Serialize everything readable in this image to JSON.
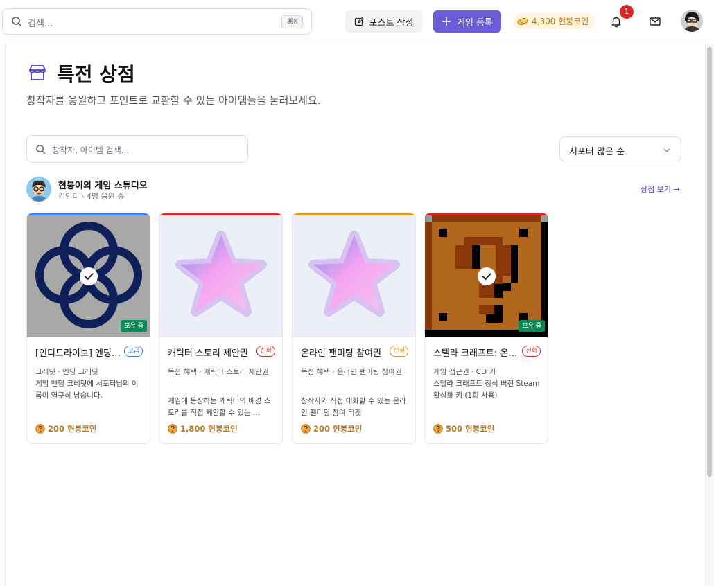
{
  "topbar": {
    "search_placeholder": "검색...",
    "shortcut": "⌘K",
    "post_button": "포스트 작성",
    "game_button": "게임 등록",
    "coin_balance": "4,300 현붕코인",
    "notification_count": "1"
  },
  "page": {
    "title": "특전 상점",
    "subtitle": "창작자를 응원하고 포인트로 교환할 수 있는 아이템들을 둘러보세요.",
    "search_placeholder": "창작자, 아이템 검색...",
    "sort_value": "서포터 많은 순"
  },
  "creator": {
    "name": "현붕이의 게임 스튜디오",
    "meta": "김인디 · 4명 응원 중",
    "store_link": "상점 보기 →"
  },
  "owned_label": "보유 중",
  "items": [
    {
      "name": "[인디드라이브] 엔딩 크레딧",
      "tier": "고급",
      "tier_color": "#3b82f6",
      "category": "크레딧 · 엔딩 크레딧",
      "description": "게임 엔딩 크레딧에 서포터님의 이름이 영구히 남습니다.",
      "price": "200 현붕코인",
      "owned": true
    },
    {
      "name": "캐릭터 스토리 제안권",
      "tier": "신화",
      "tier_color": "#dc2626",
      "category": "독점 혜택 · 캐릭터·스토리 제안권",
      "description": "게임에 등장하는 캐릭터의 배경 스토리를 직접 제안할 수 있는 ...",
      "price": "1,800 현붕코인",
      "owned": false
    },
    {
      "name": "온라인 팬미팅 참여권",
      "tier": "전설",
      "tier_color": "#e29a18",
      "category": "독점 혜택 · 온라인 팬미팅 참여권",
      "description": "창작자와 직접 대화할 수 있는 온라인 팬미팅 참여 티켓",
      "price": "200 현붕코인",
      "owned": false
    },
    {
      "name": "스텔라 크래프트: 온라인",
      "tier": "신화",
      "tier_color": "#dc2626",
      "category": "게임 접근권 · CD 키",
      "description": "스텔라 크래프트 정식 버전 Steam 활성화 키 (1회 사용)",
      "price": "500 현붕코인",
      "owned": true
    }
  ],
  "colors": {
    "accent": "#6c5bd6",
    "coin": "#b7791f",
    "owned_badge": "#0e8a5a",
    "notification": "#dc2626"
  },
  "icons": [
    "search-icon",
    "edit-icon",
    "plus-icon",
    "coin-icon",
    "bell-icon",
    "mail-icon",
    "store-icon",
    "chevron-down-icon",
    "check-icon",
    "question-coin-icon"
  ]
}
